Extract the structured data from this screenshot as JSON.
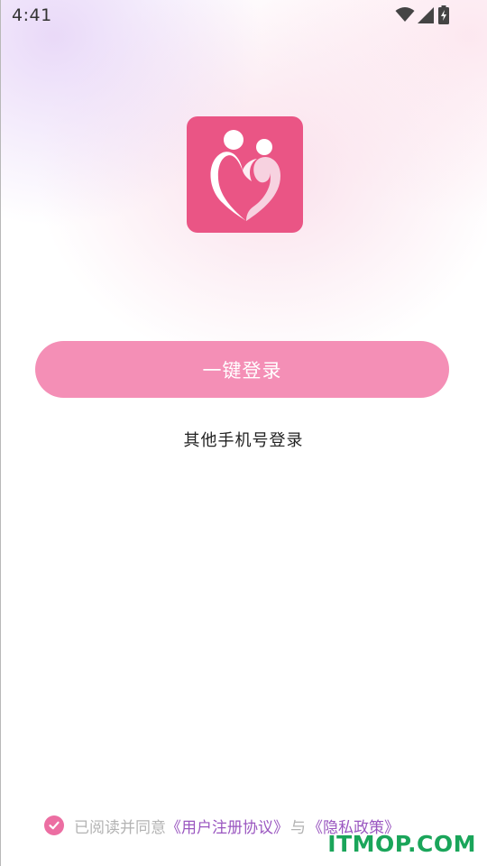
{
  "status_bar": {
    "time": "4:41",
    "icons": [
      "wifi-icon",
      "signal-icon",
      "battery-charging-icon"
    ]
  },
  "app": {
    "logo_icon": "couple-heart-logo",
    "brand_color": "#ea5585"
  },
  "login": {
    "one_click_label": "一键登录",
    "other_phone_label": "其他手机号登录",
    "button_color": "#f48fb6"
  },
  "agreement": {
    "checked": true,
    "prefix": "已阅读并同意",
    "user_agreement": "《用户注册协议》",
    "connector": "与",
    "privacy_policy": "《隐私政策》",
    "link_color": "#9a56c0"
  },
  "watermark": {
    "text": "ITMOP.COM"
  }
}
